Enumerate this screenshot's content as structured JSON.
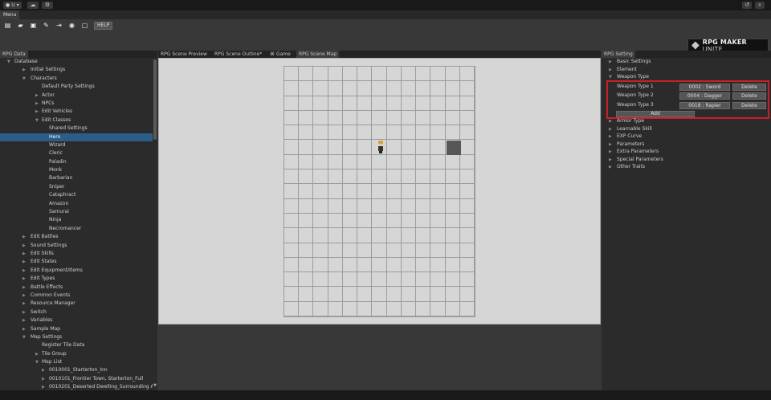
{
  "topbar": {
    "account_label": "U",
    "account_icon": "user-icon",
    "cloud_icon": "cloud-icon",
    "settings_icon": "gear-icon",
    "history_icon": "history-icon",
    "search_icon": "search-icon"
  },
  "menu": {
    "tab_label": "Menu"
  },
  "toolbar": {
    "buttons": [
      "new-file-icon",
      "open-folder-icon",
      "save-icon",
      "edit-icon",
      "export-icon",
      "play-icon",
      "deploy-icon"
    ],
    "help_label": "HELP",
    "logo_text": "RPG MAKER",
    "logo_suffix": "UNITE"
  },
  "left_panel": {
    "tab_label": "RPG Data",
    "tree": [
      {
        "label": "Database",
        "arrow": "▼",
        "level": 0
      },
      {
        "label": "Initial Settings",
        "arrow": "▶",
        "level": 1
      },
      {
        "label": "Characters",
        "arrow": "▼",
        "level": 1
      },
      {
        "label": "Default Party Settings",
        "arrow": "",
        "level": 2
      },
      {
        "label": "Actor",
        "arrow": "▶",
        "level": 2
      },
      {
        "label": "NPCs",
        "arrow": "▶",
        "level": 2
      },
      {
        "label": "Edit Vehicles",
        "arrow": "▶",
        "level": 2
      },
      {
        "label": "Edit Classes",
        "arrow": "▼",
        "level": 2
      },
      {
        "label": "Shared Settings",
        "arrow": "",
        "level": 3
      },
      {
        "label": "Hero",
        "arrow": "",
        "level": 3,
        "selected": true
      },
      {
        "label": "Wizard",
        "arrow": "",
        "level": 3
      },
      {
        "label": "Cleric",
        "arrow": "",
        "level": 3
      },
      {
        "label": "Paladin",
        "arrow": "",
        "level": 3
      },
      {
        "label": "Monk",
        "arrow": "",
        "level": 3
      },
      {
        "label": "Barbarian",
        "arrow": "",
        "level": 3
      },
      {
        "label": "Sniper",
        "arrow": "",
        "level": 3
      },
      {
        "label": "Cataphract",
        "arrow": "",
        "level": 3
      },
      {
        "label": "Amazon",
        "arrow": "",
        "level": 3
      },
      {
        "label": "Samurai",
        "arrow": "",
        "level": 3
      },
      {
        "label": "Ninja",
        "arrow": "",
        "level": 3
      },
      {
        "label": "Necromancer",
        "arrow": "",
        "level": 3
      },
      {
        "label": "Edit Battles",
        "arrow": "▶",
        "level": 1
      },
      {
        "label": "Sound Settings",
        "arrow": "▶",
        "level": 1
      },
      {
        "label": "Edit Skills",
        "arrow": "▶",
        "level": 1
      },
      {
        "label": "Edit States",
        "arrow": "▶",
        "level": 1
      },
      {
        "label": "Edit Equipment/Items",
        "arrow": "▶",
        "level": 1
      },
      {
        "label": "Edit Types",
        "arrow": "▶",
        "level": 1
      },
      {
        "label": "Battle Effects",
        "arrow": "▶",
        "level": 1
      },
      {
        "label": "Common Events",
        "arrow": "▶",
        "level": 1
      },
      {
        "label": "Resource Manager",
        "arrow": "▶",
        "level": 1
      },
      {
        "label": "Switch",
        "arrow": "▶",
        "level": 1
      },
      {
        "label": "Variables",
        "arrow": "▶",
        "level": 1
      },
      {
        "label": "Sample Map",
        "arrow": "▶",
        "level": 1
      },
      {
        "label": "Map Settings",
        "arrow": "▼",
        "level": 1
      },
      {
        "label": "Register Tile Data",
        "arrow": "",
        "level": 2
      },
      {
        "label": "Tile Group",
        "arrow": "▶",
        "level": 2
      },
      {
        "label": "Map List",
        "arrow": "▼",
        "level": 2
      },
      {
        "label": "0010001_Starterton_Inn",
        "arrow": "▶",
        "level": 3
      },
      {
        "label": "0010101_Frontier Town, Starterton_Full",
        "arrow": "▶",
        "level": 3
      },
      {
        "label": "0010201_Deserted Dwelling_Surrounding Area",
        "arrow": "▶",
        "level": 3
      }
    ]
  },
  "center": {
    "tabs": [
      {
        "label": "RPG Scene Preview",
        "active": false
      },
      {
        "label": "RPG Scene Outline*",
        "active": false
      },
      {
        "label": "Game",
        "active": false,
        "icon": "gamepad-icon"
      },
      {
        "label": "RPG Scene Map",
        "active": true
      }
    ]
  },
  "right_panel": {
    "tab_label": "RPG Setting",
    "sections_top": [
      {
        "label": "Basic Settings",
        "arrow": "▶"
      },
      {
        "label": "Element",
        "arrow": "▶"
      },
      {
        "label": "Weapon Type",
        "arrow": "▼"
      }
    ],
    "weapon_types": [
      {
        "label": "Weapon Type 1",
        "value": "0002 : Sword",
        "delete_label": "Delete"
      },
      {
        "label": "Weapon Type 2",
        "value": "0004 : Dagger",
        "delete_label": "Delete"
      },
      {
        "label": "Weapon Type 3",
        "value": "0018 : Rapier",
        "delete_label": "Delete"
      }
    ],
    "add_label": "Add",
    "sections_bottom": [
      {
        "label": "Armor Type",
        "arrow": "▶"
      },
      {
        "label": "Learnable Skill",
        "arrow": "▶"
      },
      {
        "label": "EXP Curve",
        "arrow": "▶"
      },
      {
        "label": "Parameters",
        "arrow": "▶"
      },
      {
        "label": "Extra Parameters",
        "arrow": "▶"
      },
      {
        "label": "Special Parameters",
        "arrow": "▶"
      },
      {
        "label": "Other Traits",
        "arrow": "▶"
      }
    ]
  },
  "colors": {
    "highlight_border": "#c8202a",
    "selection": "#2c5d87"
  }
}
